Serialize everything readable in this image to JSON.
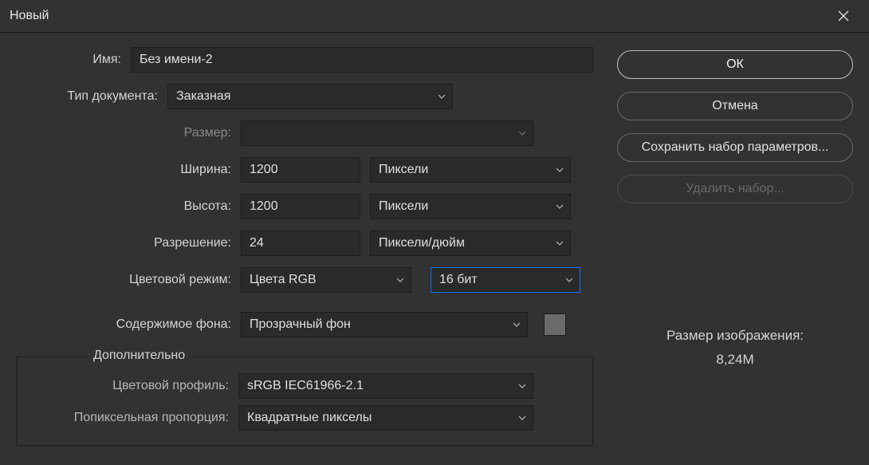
{
  "titlebar": {
    "title": "Новый"
  },
  "labels": {
    "name": "Имя:",
    "doc_type": "Тип документа:",
    "size": "Размер:",
    "width": "Ширина:",
    "height": "Высота:",
    "resolution": "Разрешение:",
    "color_mode": "Цветовой режим:",
    "background": "Содержимое фона:",
    "advanced": "Дополнительно",
    "color_profile": "Цветовой профиль:",
    "pixel_aspect": "Попиксельная пропорция:"
  },
  "values": {
    "name": "Без имени-2",
    "doc_type": "Заказная",
    "size": "",
    "width": "1200",
    "width_unit": "Пиксели",
    "height": "1200",
    "height_unit": "Пиксели",
    "resolution": "24",
    "resolution_unit": "Пиксели/дюйм",
    "color_mode": "Цвета RGB",
    "bit_depth": "16 бит",
    "background": "Прозрачный фон",
    "color_profile": "sRGB IEC61966-2.1",
    "pixel_aspect": "Квадратные пикселы"
  },
  "buttons": {
    "ok": "ОК",
    "cancel": "Отмена",
    "save_preset": "Сохранить набор параметров...",
    "delete_preset": "Удалить набор..."
  },
  "image_size": {
    "label": "Размер изображения:",
    "value": "8,24M"
  }
}
